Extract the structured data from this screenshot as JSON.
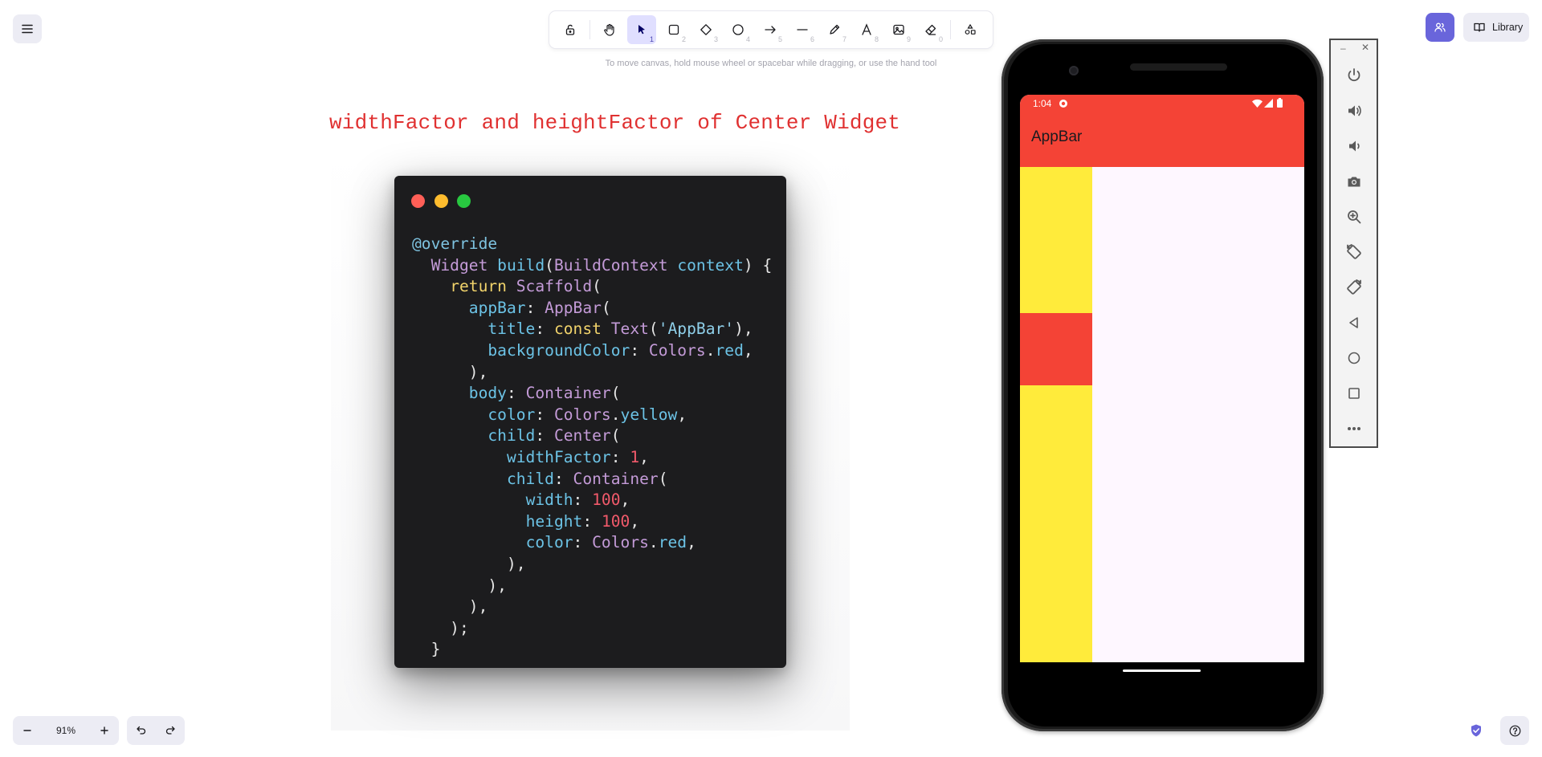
{
  "toolbar": {
    "tools": [
      {
        "name": "lock",
        "key": ""
      },
      {
        "name": "hand",
        "key": ""
      },
      {
        "name": "selection",
        "key": "1",
        "active": true
      },
      {
        "name": "rectangle",
        "key": "2"
      },
      {
        "name": "diamond",
        "key": "3"
      },
      {
        "name": "ellipse",
        "key": "4"
      },
      {
        "name": "arrow",
        "key": "5"
      },
      {
        "name": "line",
        "key": "6"
      },
      {
        "name": "draw",
        "key": "7"
      },
      {
        "name": "text",
        "key": "8"
      },
      {
        "name": "image",
        "key": "9"
      },
      {
        "name": "eraser",
        "key": "0"
      },
      {
        "name": "extra-tools",
        "key": ""
      }
    ]
  },
  "hint": "To move canvas, hold mouse wheel or spacebar while dragging, or use the hand tool",
  "header": {
    "library_label": "Library"
  },
  "canvas": {
    "heading": "widthFactor and heightFactor of Center Widget",
    "code_lines": [
      [
        [
          "@override",
          "ann"
        ]
      ],
      [
        [
          "  ",
          "pun"
        ],
        [
          "Widget",
          "cls"
        ],
        [
          " ",
          "pun"
        ],
        [
          "build",
          "prop"
        ],
        [
          "(",
          "pun"
        ],
        [
          "BuildContext",
          "cls"
        ],
        [
          " ",
          "pun"
        ],
        [
          "context",
          "prop"
        ],
        [
          ") {",
          "pun"
        ]
      ],
      [
        [
          "    ",
          "pun"
        ],
        [
          "return",
          "kw"
        ],
        [
          " ",
          "pun"
        ],
        [
          "Scaffold",
          "cls"
        ],
        [
          "(",
          "pun"
        ]
      ],
      [
        [
          "      ",
          "pun"
        ],
        [
          "appBar",
          "prop"
        ],
        [
          ": ",
          "pun"
        ],
        [
          "AppBar",
          "cls"
        ],
        [
          "(",
          "pun"
        ]
      ],
      [
        [
          "        ",
          "pun"
        ],
        [
          "title",
          "prop"
        ],
        [
          ": ",
          "pun"
        ],
        [
          "const",
          "kw"
        ],
        [
          " ",
          "pun"
        ],
        [
          "Text",
          "cls"
        ],
        [
          "(",
          "pun"
        ],
        [
          "'AppBar'",
          "str"
        ],
        [
          "),",
          "pun"
        ]
      ],
      [
        [
          "        ",
          "pun"
        ],
        [
          "backgroundColor",
          "prop"
        ],
        [
          ": ",
          "pun"
        ],
        [
          "Colors",
          "cls"
        ],
        [
          ".",
          "pun"
        ],
        [
          "red",
          "prop"
        ],
        [
          ",",
          "pun"
        ]
      ],
      [
        [
          "      ),",
          "pun"
        ]
      ],
      [
        [
          "      ",
          "pun"
        ],
        [
          "body",
          "prop"
        ],
        [
          ": ",
          "pun"
        ],
        [
          "Container",
          "cls"
        ],
        [
          "(",
          "pun"
        ]
      ],
      [
        [
          "        ",
          "pun"
        ],
        [
          "color",
          "prop"
        ],
        [
          ": ",
          "pun"
        ],
        [
          "Colors",
          "cls"
        ],
        [
          ".",
          "pun"
        ],
        [
          "yellow",
          "prop"
        ],
        [
          ",",
          "pun"
        ]
      ],
      [
        [
          "        ",
          "pun"
        ],
        [
          "child",
          "prop"
        ],
        [
          ": ",
          "pun"
        ],
        [
          "Center",
          "cls"
        ],
        [
          "(",
          "pun"
        ]
      ],
      [
        [
          "          ",
          "pun"
        ],
        [
          "widthFactor",
          "prop"
        ],
        [
          ": ",
          "pun"
        ],
        [
          "1",
          "num"
        ],
        [
          ",",
          "pun"
        ]
      ],
      [
        [
          "          ",
          "pun"
        ],
        [
          "child",
          "prop"
        ],
        [
          ": ",
          "pun"
        ],
        [
          "Container",
          "cls"
        ],
        [
          "(",
          "pun"
        ]
      ],
      [
        [
          "            ",
          "pun"
        ],
        [
          "width",
          "prop"
        ],
        [
          ": ",
          "pun"
        ],
        [
          "100",
          "num"
        ],
        [
          ",",
          "pun"
        ]
      ],
      [
        [
          "            ",
          "pun"
        ],
        [
          "height",
          "prop"
        ],
        [
          ": ",
          "pun"
        ],
        [
          "100",
          "num"
        ],
        [
          ",",
          "pun"
        ]
      ],
      [
        [
          "            ",
          "pun"
        ],
        [
          "color",
          "prop"
        ],
        [
          ": ",
          "pun"
        ],
        [
          "Colors",
          "cls"
        ],
        [
          ".",
          "pun"
        ],
        [
          "red",
          "prop"
        ],
        [
          ",",
          "pun"
        ]
      ],
      [
        [
          "          ),",
          "pun"
        ]
      ],
      [
        [
          "        ),",
          "pun"
        ]
      ],
      [
        [
          "      ),",
          "pun"
        ]
      ],
      [
        [
          "    );",
          "pun"
        ]
      ],
      [
        [
          "  }",
          "pun"
        ]
      ]
    ]
  },
  "phone": {
    "time": "1:04",
    "appbar_title": "AppBar"
  },
  "footer": {
    "zoom": "91%"
  },
  "colors": {
    "accent": "#6965db",
    "heading": "#e03131",
    "flutter_red": "#f44336",
    "flutter_yellow": "#ffeb3b"
  }
}
